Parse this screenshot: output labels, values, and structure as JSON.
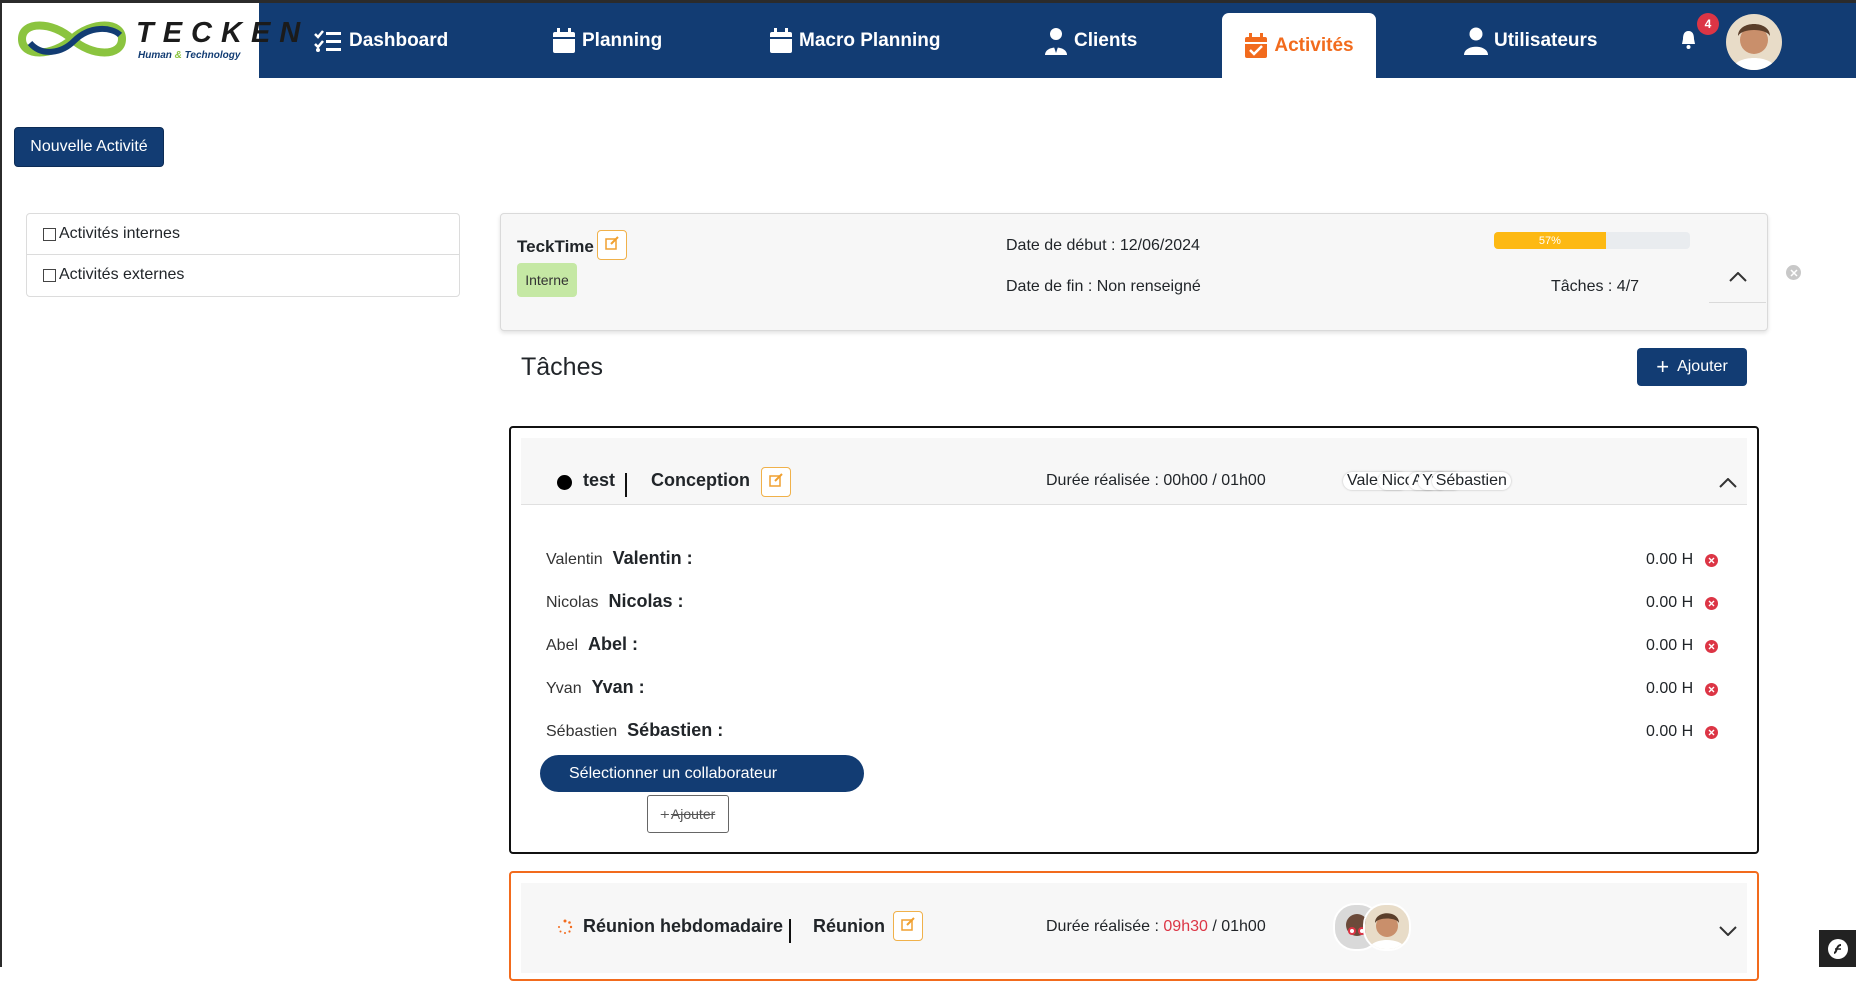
{
  "logo": {
    "title": "TECKEN",
    "subtitle_part1": "Human ",
    "subtitle_amp": "&",
    "subtitle_part2": " Technology"
  },
  "nav": {
    "items": [
      {
        "label": "Dashboard",
        "icon": "list-check-icon"
      },
      {
        "label": "Planning",
        "icon": "calendar-icon"
      },
      {
        "label": "Macro Planning",
        "icon": "calendar-icon"
      },
      {
        "label": "Clients",
        "icon": "user-tie-icon"
      },
      {
        "label": "Activités",
        "icon": "calendar-check-icon",
        "active": true
      },
      {
        "label": "Utilisateurs",
        "icon": "user-icon"
      }
    ],
    "notifications_count": "4"
  },
  "actions": {
    "new_activity": "Nouvelle Activité"
  },
  "filters": {
    "internal": "Activités internes",
    "external": "Activités externes"
  },
  "activity": {
    "name": "TeckTime",
    "tag": "Interne",
    "start_date": "Date de début : 12/06/2024",
    "end_date": "Date de fin : Non renseigné",
    "progress_label": "57%",
    "progress_value": 57,
    "tasks_count": "Tâches : 4/7"
  },
  "tasks_section": {
    "title": "Tâches",
    "add_label": "Ajouter"
  },
  "task1": {
    "name": "test",
    "type": "Conception",
    "duree_label": "Durée réalisée : 00h00 / 01h00",
    "stacked_names": [
      "Valentin",
      "Nicolas",
      "Abel",
      "Yvan",
      "Sébastien"
    ],
    "members": [
      {
        "short": "Valentin",
        "name": "Valentin :",
        "hours": "0.00 H"
      },
      {
        "short": "Nicolas",
        "name": "Nicolas :",
        "hours": "0.00 H"
      },
      {
        "short": "Abel",
        "name": "Abel :",
        "hours": "0.00 H"
      },
      {
        "short": "Yvan",
        "name": "Yvan :",
        "hours": "0.00 H"
      },
      {
        "short": "Sébastien",
        "name": "Sébastien :",
        "hours": "0.00 H"
      }
    ],
    "select_collab": "Sélectionner un collaborateur",
    "add_small": "Ajouter"
  },
  "task2": {
    "name": "Réunion hebdomadaire",
    "type": "Réunion",
    "duree_prefix": "Durée réalisée : ",
    "duree_done": "09h30",
    "duree_total": " / 01h00"
  },
  "colors": {
    "navy": "#123c73",
    "orange": "#f26b1d",
    "progress": "#fdb913",
    "tag_green": "#c5e8a4",
    "danger": "#dc3545"
  }
}
